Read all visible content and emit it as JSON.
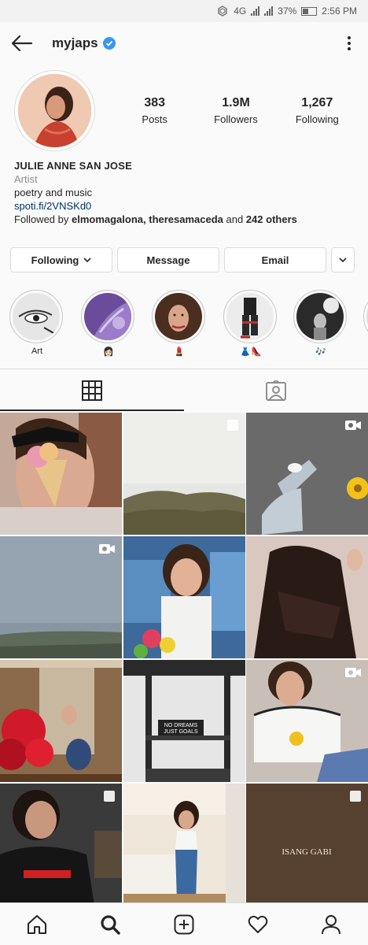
{
  "status_bar": {
    "network": "4G",
    "battery": "37%",
    "time": "2:56 PM"
  },
  "header": {
    "username": "myjaps",
    "icons": [
      "back-arrow-icon",
      "verified-badge-icon",
      "more-vertical-icon"
    ]
  },
  "profile": {
    "stats": [
      {
        "value": "383",
        "label": "Posts"
      },
      {
        "value": "1.9M",
        "label": "Followers"
      },
      {
        "value": "1,267",
        "label": "Following"
      }
    ],
    "full_name": "JULIE ANNE SAN JOSE",
    "category": "Artist",
    "bio": "poetry and music",
    "link": "spoti.fi/2VNSKd0",
    "followed_by_prefix": "Followed by ",
    "followed_by_names": "elmomagalona, theresamaceda",
    "followed_by_and": " and ",
    "followed_by_others": "242 others"
  },
  "buttons": {
    "following": "Following",
    "message": "Message",
    "email": "Email"
  },
  "highlights": [
    {
      "caption": "Art"
    },
    {
      "caption": "👩🏻"
    },
    {
      "caption": "💄"
    },
    {
      "caption": "👗👠"
    },
    {
      "caption": "🎶"
    }
  ],
  "tabs": [
    "grid-icon",
    "tagged-icon"
  ],
  "grid_badges": [
    "none",
    "carousel",
    "video",
    "video",
    "none",
    "none",
    "none",
    "none",
    "video",
    "carousel",
    "none",
    "carousel"
  ],
  "grid_text": {
    "post6_sign_line1": "NO DREAMS",
    "post6_sign_line2": "JUST GOALS",
    "post12_title": "ISANG GABI"
  },
  "bottom_nav": [
    "home-icon",
    "search-icon",
    "new-post-icon",
    "activity-heart-icon",
    "profile-icon"
  ],
  "colors": {
    "verified": "#3897f0",
    "link": "#003569",
    "muted": "#8e8e8e"
  }
}
